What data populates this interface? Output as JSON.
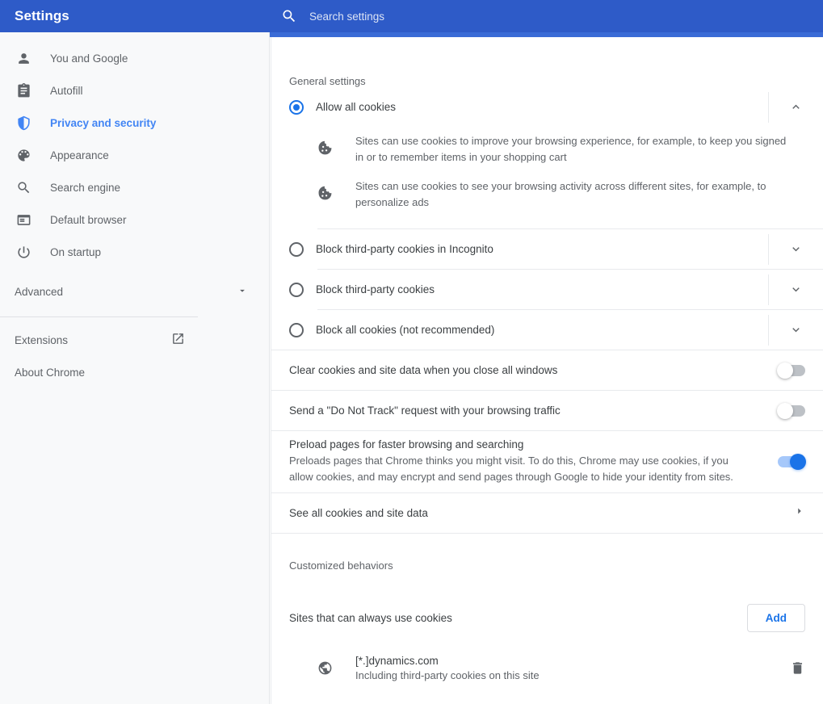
{
  "header": {
    "title": "Settings",
    "search_placeholder": "Search settings",
    "search_value": "",
    "search_icon": "search-icon",
    "background_color": "#2e5bc8"
  },
  "sidebar": {
    "items": [
      {
        "label": "You and Google",
        "icon": "person-icon",
        "active": false
      },
      {
        "label": "Autofill",
        "icon": "clipboard-icon",
        "active": false
      },
      {
        "label": "Privacy and security",
        "icon": "shield-icon",
        "active": true
      },
      {
        "label": "Appearance",
        "icon": "palette-icon",
        "active": false
      },
      {
        "label": "Search engine",
        "icon": "search-icon",
        "active": false
      },
      {
        "label": "Default browser",
        "icon": "browser-window-icon",
        "active": false
      },
      {
        "label": "On startup",
        "icon": "power-icon",
        "active": false
      }
    ],
    "advanced": {
      "label": "Advanced",
      "icon": "chevron-down-icon"
    },
    "footer_items": [
      {
        "label": "Extensions",
        "icon": "external-link-icon"
      },
      {
        "label": "About Chrome",
        "icon": ""
      }
    ],
    "active_color": "#4285f4"
  },
  "main": {
    "general_settings_title": "General settings",
    "cookie_options": [
      {
        "label": "Allow all cookies",
        "selected": true,
        "expanded": true,
        "expander_icon": "chevron-up-icon",
        "details": [
          {
            "icon": "cookie-icon",
            "text": "Sites can use cookies to improve your browsing experience, for example, to keep you signed in or to remember items in your shopping cart"
          },
          {
            "icon": "cookie-icon",
            "text": "Sites can use cookies to see your browsing activity across different sites, for example, to personalize ads"
          }
        ]
      },
      {
        "label": "Block third-party cookies in Incognito",
        "selected": false,
        "expanded": false,
        "expander_icon": "chevron-down-icon",
        "details": []
      },
      {
        "label": "Block third-party cookies",
        "selected": false,
        "expanded": false,
        "expander_icon": "chevron-down-icon",
        "details": []
      },
      {
        "label": "Block all cookies (not recommended)",
        "selected": false,
        "expanded": false,
        "expander_icon": "chevron-down-icon",
        "details": []
      }
    ],
    "toggles": [
      {
        "title": "Clear cookies and site data when you close all windows",
        "sub": "",
        "on": false
      },
      {
        "title": "Send a \"Do Not Track\" request with your browsing traffic",
        "sub": "",
        "on": false
      },
      {
        "title": "Preload pages for faster browsing and searching",
        "sub": "Preloads pages that Chrome thinks you might visit. To do this, Chrome may use cookies, if you allow cookies, and may encrypt and send pages through Google to hide your identity from sites.",
        "on": true
      }
    ],
    "see_all": {
      "label": "See all cookies and site data",
      "icon": "chevron-right-icon"
    },
    "customized_behaviors_title": "Customized behaviors",
    "sites_always_allow": {
      "label": "Sites that can always use cookies",
      "add_button": "Add",
      "entries": [
        {
          "icon": "globe-icon",
          "name": "[*.]dynamics.com",
          "sub": "Including third-party cookies on this site",
          "delete_icon": "trash-icon"
        }
      ]
    },
    "accent_color": "#1a73e8"
  }
}
